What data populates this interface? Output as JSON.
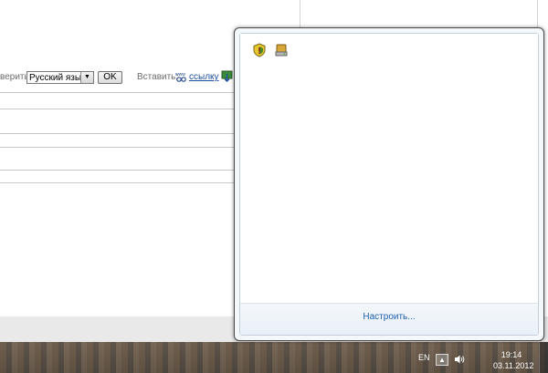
{
  "browser": {
    "toolbar": {
      "check_label_partial": "верить",
      "language_select_value": "Русский язык",
      "ok_label": "OK",
      "insert_label": "Вставить:",
      "link_label": "ссылку"
    }
  },
  "tray_popup": {
    "customize_label": "Настроить...",
    "icons": [
      "shield-warning-icon",
      "network-drive-icon"
    ]
  },
  "taskbar": {
    "language": "EN",
    "show_hidden_icons_glyph": "▲",
    "volume_glyph": "🔊",
    "time": "19:14",
    "date": "03.11.2012"
  }
}
